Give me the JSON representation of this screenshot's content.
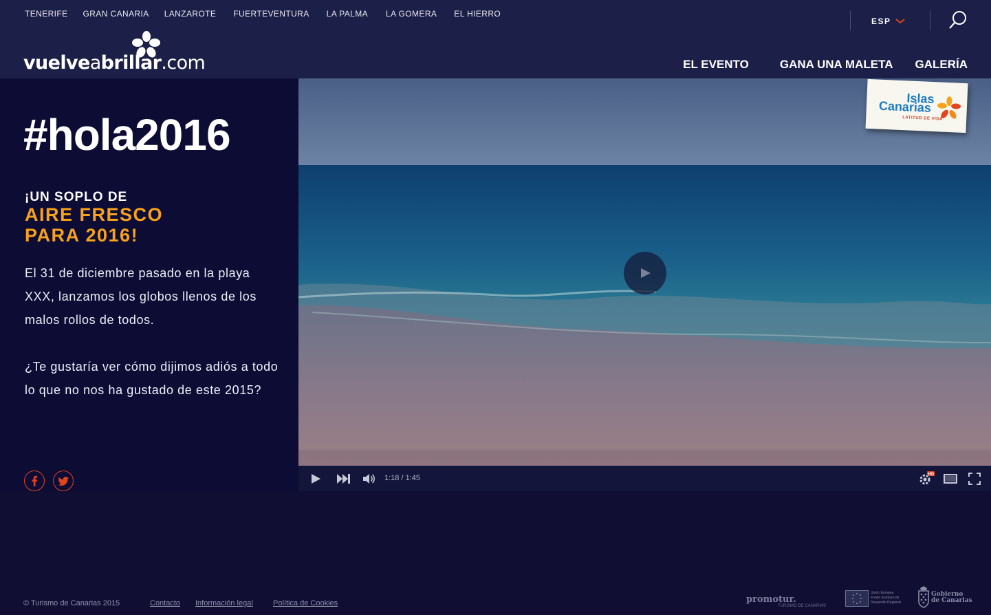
{
  "header": {
    "islands": [
      "TENERIFE",
      "GRAN CANARIA",
      "LANZAROTE",
      "FUERTEVENTURA",
      "LA PALMA",
      "LA GOMERA",
      "EL HIERRO"
    ],
    "logo": {
      "part1": "vuelve",
      "part2": "a",
      "part3": "brillar",
      "part4": ".com"
    },
    "language": "ESP",
    "search_icon": "search-icon",
    "main_nav": [
      "EL EVENTO",
      "GANA UNA MALETA",
      "GALERÍA"
    ]
  },
  "hero": {
    "hashtag": "#hola2016",
    "kicker": "¡UN SOPLO DE",
    "headline_line1": "AIRE FRESCO",
    "headline_line2": "PARA 2016!",
    "paragraph1": "El 31 de diciembre pasado en la playa XXX, lanzamos los globos llenos de los malos rollos de todos.",
    "paragraph2": "¿Te gustaría ver cómo dijimos adiós a todo lo que no nos ha gustado de este 2015?",
    "social": [
      "facebook-icon",
      "twitter-icon"
    ]
  },
  "video": {
    "time": "1:18 / 1:45",
    "hd_badge": "HD",
    "badge": {
      "line1": "Islas",
      "line2": "Canarias",
      "tagline": "LATITUD DE VIDA"
    }
  },
  "footer": {
    "copyright": "© Turismo de Canarias 2015",
    "links": [
      "Contacto",
      "Información legal",
      "Política de Cookies"
    ],
    "partners": {
      "promotur": "promotur.",
      "promotur_sub": "TURISMO DE CANARIAS",
      "ue": "Unión Europea",
      "ue_sub1": "Fondo Europeo de",
      "ue_sub2": "Desarrollo Regional",
      "gob1": "Gobierno",
      "gob2": "de Canarias"
    }
  },
  "colors": {
    "header_bg": "#1c2048",
    "page_bg": "#100e33",
    "accent_orange": "#f7a21b",
    "social_red": "#e2441d"
  }
}
